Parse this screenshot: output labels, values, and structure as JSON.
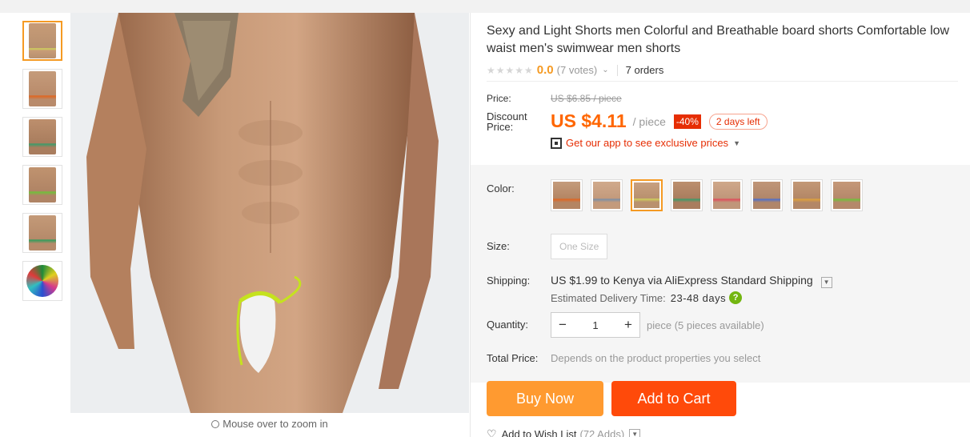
{
  "gallery": {
    "zoom_hint": "Mouse over to zoom in",
    "thumbnails": [
      {
        "name": "thumb-1",
        "colors": [
          "#b8916f",
          "#d0d35a"
        ]
      },
      {
        "name": "thumb-2",
        "colors": [
          "#b98b6b",
          "#e1651f"
        ]
      },
      {
        "name": "thumb-3",
        "colors": [
          "#a97d5e",
          "#3a9c6a"
        ]
      },
      {
        "name": "thumb-4",
        "colors": [
          "#b08465",
          "#6fc23a"
        ]
      },
      {
        "name": "thumb-5",
        "colors": [
          "#b58a6a",
          "#2f9e5c"
        ]
      },
      {
        "name": "thumb-6",
        "colors": [
          "#1e8a3a",
          "#d63a8c"
        ]
      }
    ]
  },
  "product": {
    "title": "Sexy and Light Shorts men Colorful and Breathable board shorts Comfortable low waist men's swimwear men shorts",
    "stars": "★★★★★",
    "rating": "0.0",
    "votes": "(7 votes)",
    "orders": "7 orders",
    "price_label": "Price:",
    "old_price": "US $6.85 / piece",
    "discount_label_1": "Discount",
    "discount_label_2": "Price:",
    "current_price": "US $4.11",
    "per_unit": "/ piece",
    "discount_percent": "-40%",
    "time_left": "2 days left",
    "app_promo": "Get our app to see exclusive prices"
  },
  "options": {
    "color_label": "Color:",
    "swatches": [
      {
        "colors": [
          "#b48563",
          "#e1651f"
        ]
      },
      {
        "colors": [
          "#c39a7c",
          "#7a8fa8"
        ]
      },
      {
        "colors": [
          "#b9916e",
          "#d0d35a"
        ]
      },
      {
        "colors": [
          "#a97d5e",
          "#3a9c6a"
        ]
      },
      {
        "colors": [
          "#c0967a",
          "#e04a5a"
        ]
      },
      {
        "colors": [
          "#b0866a",
          "#4a6fd0"
        ]
      },
      {
        "colors": [
          "#b38766",
          "#e0a23a"
        ]
      },
      {
        "colors": [
          "#b5886a",
          "#6fc23a"
        ]
      }
    ],
    "size_label": "Size:",
    "size_value": "One Size",
    "shipping_label": "Shipping:",
    "shipping_price": "US $1.99",
    "shipping_to": "to Kenya via AliExpress Standard Shipping",
    "eta_label": "Estimated Delivery Time:",
    "eta_value": "23-48 days",
    "quantity_label": "Quantity:",
    "quantity_value": "1",
    "quantity_note": "piece (5 pieces available)",
    "total_label": "Total Price:",
    "total_note": "Depends on the product properties you select"
  },
  "actions": {
    "buy_now": "Buy Now",
    "add_to_cart": "Add to Cart",
    "wish_list": "Add to Wish List",
    "wish_adds": "(72 Adds)"
  },
  "colors": {
    "accent_orange": "#f59a23",
    "price_orange": "#ff6600",
    "cart_red": "#ff4a0a",
    "buy_orange": "#ff9a30"
  }
}
